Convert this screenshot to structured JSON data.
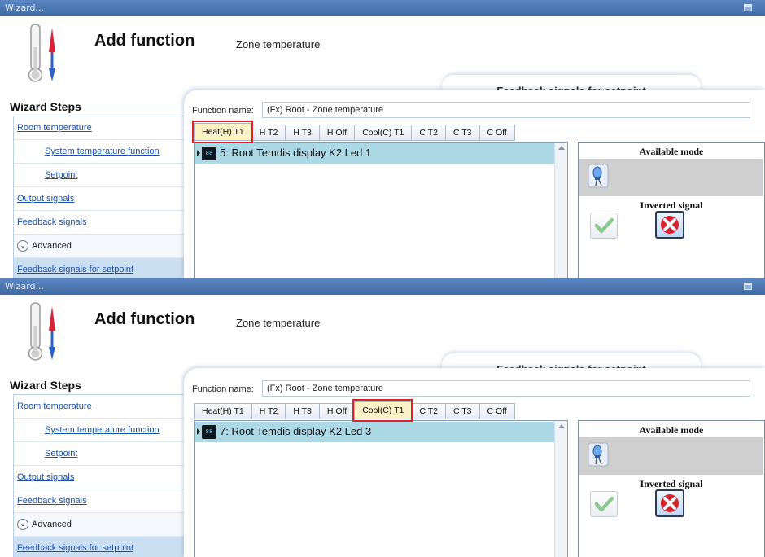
{
  "panels": [
    {
      "window_title": "Wizard...",
      "heading": "Add function",
      "subheading": "Zone temperature",
      "current_step_banner": "Feedback signals for setpoint",
      "wizard_steps_title": "Wizard Steps",
      "steps": [
        {
          "label": "Room temperature"
        },
        {
          "label": "System temperature function"
        },
        {
          "label": "Setpoint"
        },
        {
          "label": "Output signals"
        },
        {
          "label": "Feedback signals"
        },
        {
          "label": "Advanced"
        },
        {
          "label": "Feedback signals for setpoint"
        }
      ],
      "function_name_label": "Function name:",
      "function_name_value": "(Fx) Root - Zone temperature",
      "tabs": [
        "Heat(H) T1",
        "H T2",
        "H T3",
        "H Off",
        "Cool(C) T1",
        "C T2",
        "C T3",
        "C Off"
      ],
      "active_tab": "Heat(H) T1",
      "list_items": [
        "5: Root Temdis display K2 Led 1"
      ],
      "available_mode_label": "Available mode",
      "inverted_signal_label": "Inverted signal"
    },
    {
      "window_title": "Wizard...",
      "heading": "Add function",
      "subheading": "Zone temperature",
      "current_step_banner": "Feedback signals for setpoint",
      "wizard_steps_title": "Wizard Steps",
      "steps": [
        {
          "label": "Room temperature"
        },
        {
          "label": "System temperature function"
        },
        {
          "label": "Setpoint"
        },
        {
          "label": "Output signals"
        },
        {
          "label": "Feedback signals"
        },
        {
          "label": "Advanced"
        },
        {
          "label": "Feedback signals for setpoint"
        }
      ],
      "function_name_label": "Function name:",
      "function_name_value": "(Fx) Root - Zone temperature",
      "tabs": [
        "Heat(H) T1",
        "H T2",
        "H T3",
        "H Off",
        "Cool(C) T1",
        "C T2",
        "C T3",
        "C Off"
      ],
      "active_tab": "Cool(C) T1",
      "list_items": [
        "7: Root Temdis display K2 Led 3"
      ],
      "available_mode_label": "Available mode",
      "inverted_signal_label": "Inverted signal"
    }
  ],
  "icons": {
    "thermometer": "thermometer-icon",
    "led_mode": "led-mode-icon",
    "check": "check-icon",
    "cross": "cross-icon",
    "display_device": "display-device-icon"
  },
  "colors": {
    "titlebar": "#4a76b3",
    "selected_row": "#add8e6",
    "active_tab": "#fdf1c8",
    "highlight_border": "#d9252b",
    "link": "#1c4fa6"
  },
  "icon_glyph_display": "88"
}
